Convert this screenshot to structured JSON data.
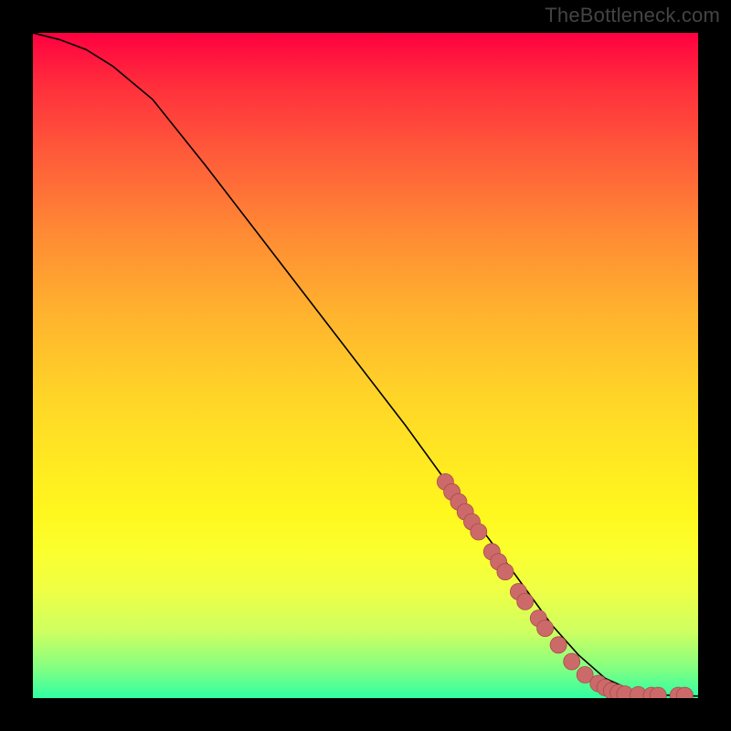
{
  "watermark": "TheBottleneck.com",
  "colors": {
    "background": "#000000",
    "curve": "#000000",
    "marker_fill": "#cc6a6a",
    "marker_stroke": "#aa4a4a"
  },
  "chart_data": {
    "type": "line",
    "title": "",
    "xlabel": "",
    "ylabel": "",
    "xlim": [
      0,
      100
    ],
    "ylim": [
      0,
      100
    ],
    "series": [
      {
        "name": "curve",
        "x": [
          0,
          4,
          8,
          12,
          18,
          26,
          36,
          46,
          56,
          64,
          70,
          74,
          78,
          82,
          86,
          90,
          94,
          100
        ],
        "y": [
          100,
          99,
          97.5,
          95,
          90,
          80,
          67,
          54,
          41,
          30,
          22,
          16.5,
          11,
          6.5,
          3,
          1.2,
          0.5,
          0.3
        ]
      }
    ],
    "scatter": {
      "name": "data-points",
      "points": [
        {
          "x": 62,
          "y": 32.5
        },
        {
          "x": 63,
          "y": 31.0
        },
        {
          "x": 64,
          "y": 29.5
        },
        {
          "x": 65,
          "y": 28.0
        },
        {
          "x": 66,
          "y": 26.5
        },
        {
          "x": 67,
          "y": 25.0
        },
        {
          "x": 69,
          "y": 22.0
        },
        {
          "x": 70,
          "y": 20.5
        },
        {
          "x": 71,
          "y": 19.0
        },
        {
          "x": 73,
          "y": 16.0
        },
        {
          "x": 74,
          "y": 14.5
        },
        {
          "x": 76,
          "y": 12.0
        },
        {
          "x": 77,
          "y": 10.5
        },
        {
          "x": 79,
          "y": 8.0
        },
        {
          "x": 81,
          "y": 5.5
        },
        {
          "x": 83,
          "y": 3.5
        },
        {
          "x": 85,
          "y": 2.2
        },
        {
          "x": 86,
          "y": 1.6
        },
        {
          "x": 87,
          "y": 1.1
        },
        {
          "x": 88,
          "y": 0.8
        },
        {
          "x": 89,
          "y": 0.6
        },
        {
          "x": 91,
          "y": 0.5
        },
        {
          "x": 93,
          "y": 0.4
        },
        {
          "x": 94,
          "y": 0.4
        },
        {
          "x": 97,
          "y": 0.4
        },
        {
          "x": 98,
          "y": 0.4
        }
      ]
    }
  }
}
